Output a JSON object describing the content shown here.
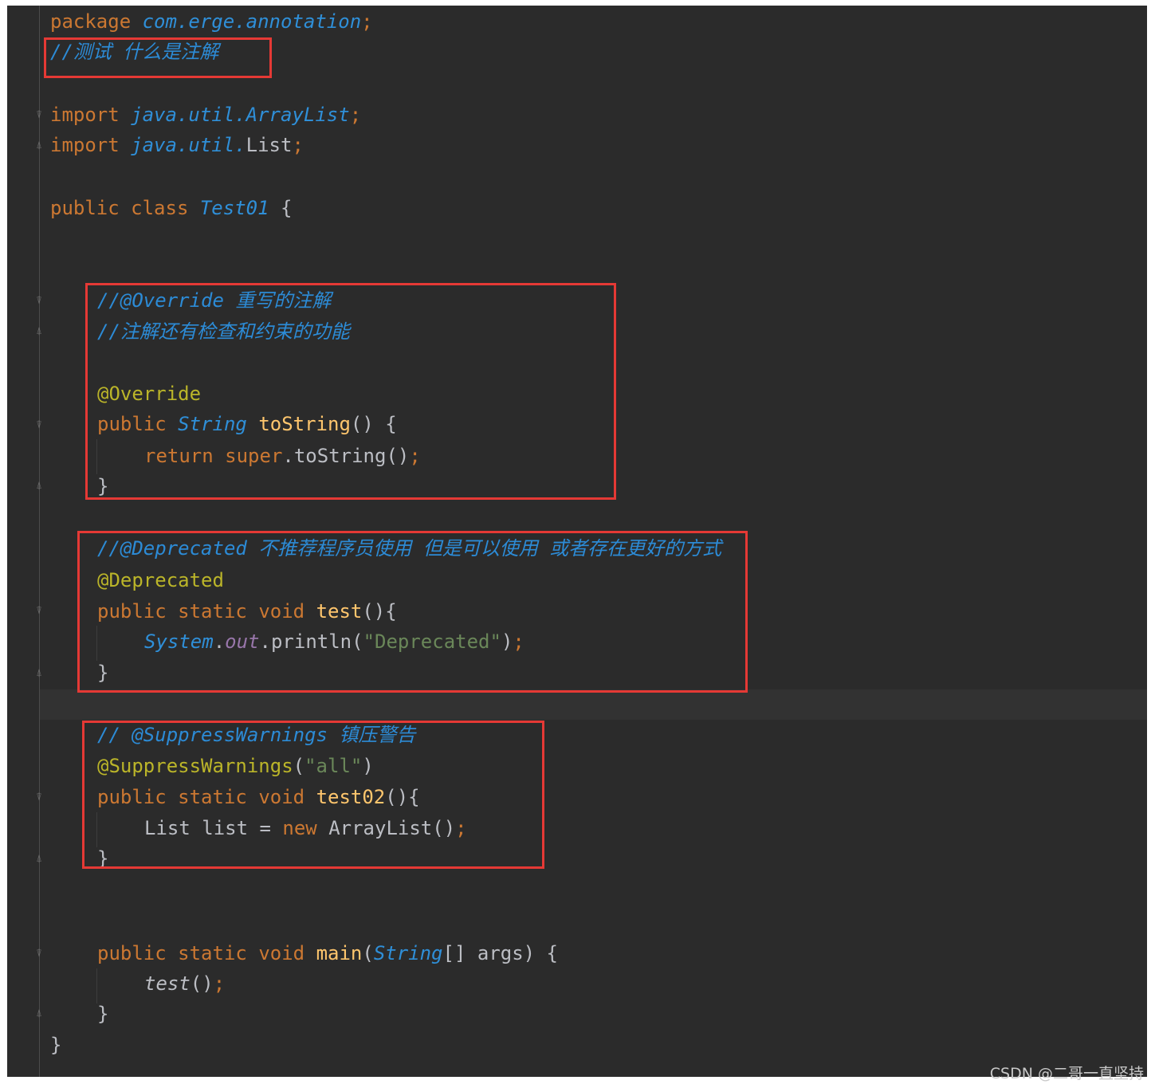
{
  "editor": {
    "lines": {
      "l1": {
        "kw": "package",
        "pkg": "com.erge.annotation",
        "semi": ";"
      },
      "l2": {
        "cmt": "//测试 什么是注解"
      },
      "l3": {
        "kw": "import",
        "pkg": "java.util.ArrayList",
        "semi": ";"
      },
      "l4": {
        "kw": "import",
        "pkg": "java.util.",
        "cls": "List",
        "semi": ";"
      },
      "l5": {
        "kw1": "public",
        "kw2": "class",
        "cls": "Test01",
        "brace": "{"
      },
      "l6": {
        "cmt": "//@Override 重写的注解"
      },
      "l7": {
        "cmt": "//注解还有检查和约束的功能"
      },
      "l8": {
        "ann": "@Override"
      },
      "l9": {
        "kw": "public",
        "cls": "String",
        "fn": "toString",
        "rest": "() {"
      },
      "l10": {
        "kw1": "return",
        "kw2": "super",
        "rest": ".toString()",
        "semi": ";"
      },
      "l11": {
        "brace": "}"
      },
      "l12": {
        "cmt": "//@Deprecated 不推荐程序员使用 但是可以使用 或者存在更好的方式"
      },
      "l13": {
        "ann": "@Deprecated"
      },
      "l14": {
        "kw1": "public",
        "kw2": "static",
        "kw3": "void",
        "fn": "test",
        "rest": "(){"
      },
      "l15": {
        "cls": "System",
        "dot1": ".",
        "fld": "out",
        "rest": ".println(",
        "str": "\"Deprecated\"",
        "close": ")",
        "semi": ";"
      },
      "l16": {
        "brace": "}"
      },
      "l17": {
        "cmt": "// @SuppressWarnings 镇压警告"
      },
      "l18": {
        "ann": "@SuppressWarnings",
        "open": "(",
        "str": "\"all\"",
        "close": ")"
      },
      "l19": {
        "kw1": "public",
        "kw2": "static",
        "kw3": "void",
        "fn": "test02",
        "rest": "(){"
      },
      "l20": {
        "plain1": "List list = ",
        "kw": "new",
        "plain2": " ArrayList()",
        "semi": ";"
      },
      "l21": {
        "brace": "}"
      },
      "l22": {
        "kw1": "public",
        "kw2": "static",
        "kw3": "void",
        "fn": "main",
        "open": "(",
        "cls": "String",
        "rest": "[] args) {"
      },
      "l23": {
        "fn": "test",
        "rest": "()",
        "semi": ";"
      },
      "l24": {
        "brace": "}"
      },
      "l25": {
        "brace": "}"
      }
    }
  },
  "watermark": {
    "text": "CSDN @二哥一直坚持"
  },
  "colors": {
    "background": "#2b2b2b",
    "keyword": "#cc7832",
    "comment": "#2c8bd6",
    "annotation": "#bbb529",
    "method": "#ffc66d",
    "string": "#6a8759",
    "highlight_box": "#e53935"
  }
}
